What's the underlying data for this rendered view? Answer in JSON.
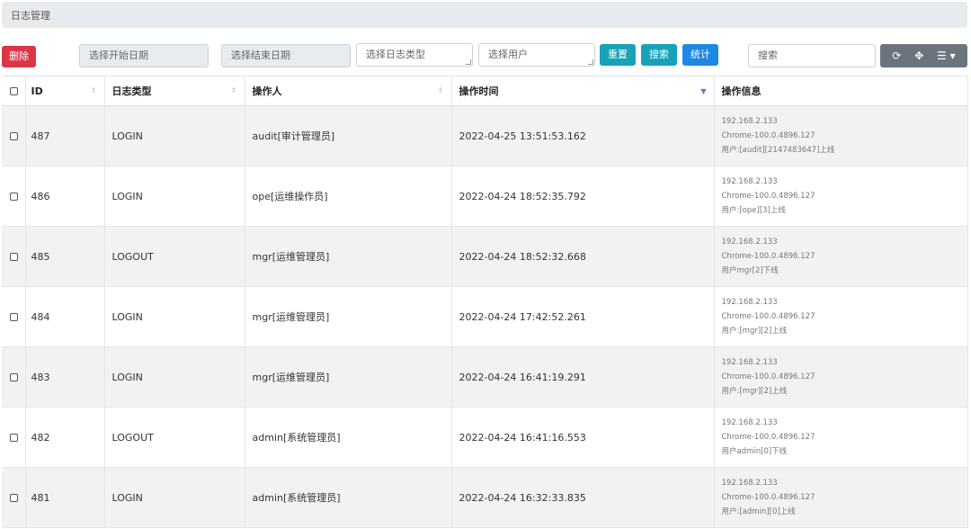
{
  "breadcrumb": {
    "title": "日志管理"
  },
  "toolbar": {
    "delete_label": "删除",
    "start_date_placeholder": "选择开始日期",
    "end_date_placeholder": "选择结束日期",
    "log_type_placeholder": "选择日志类型",
    "user_placeholder": "选择用户",
    "reset_label": "重置",
    "search_label": "搜索",
    "stats_label": "统计",
    "search_placeholder": "搜索",
    "refresh_icon": "⟳",
    "move_icon": "✥",
    "columns_icon": "☰ ▾"
  },
  "table": {
    "headers": {
      "id": "ID",
      "type": "日志类型",
      "operator": "操作人",
      "time": "操作时间",
      "info": "操作信息"
    },
    "rows": [
      {
        "id": "487",
        "type": "LOGIN",
        "operator": "audit[审计管理员]",
        "time": "2022-04-25 13:51:53.162",
        "ip": "192.168.2.133",
        "agent": "Chrome-100.0.4896.127",
        "msg": "用户:[audit][2147483647]上线"
      },
      {
        "id": "486",
        "type": "LOGIN",
        "operator": "ope[运维操作员]",
        "time": "2022-04-24 18:52:35.792",
        "ip": "192.168.2.133",
        "agent": "Chrome-100.0.4896.127",
        "msg": "用户:[ope][3]上线"
      },
      {
        "id": "485",
        "type": "LOGOUT",
        "operator": "mgr[运维管理员]",
        "time": "2022-04-24 18:52:32.668",
        "ip": "192.168.2.133",
        "agent": "Chrome-100.0.4896.127",
        "msg": "用户mgr[2]下线"
      },
      {
        "id": "484",
        "type": "LOGIN",
        "operator": "mgr[运维管理员]",
        "time": "2022-04-24 17:42:52.261",
        "ip": "192.168.2.133",
        "agent": "Chrome-100.0.4896.127",
        "msg": "用户:[mgr][2]上线"
      },
      {
        "id": "483",
        "type": "LOGIN",
        "operator": "mgr[运维管理员]",
        "time": "2022-04-24 16:41:19.291",
        "ip": "192.168.2.133",
        "agent": "Chrome-100.0.4896.127",
        "msg": "用户:[mgr][2]上线"
      },
      {
        "id": "482",
        "type": "LOGOUT",
        "operator": "admin[系统管理员]",
        "time": "2022-04-24 16:41:16.553",
        "ip": "192.168.2.133",
        "agent": "Chrome-100.0.4896.127",
        "msg": "用户admin[0]下线"
      },
      {
        "id": "481",
        "type": "LOGIN",
        "operator": "admin[系统管理员]",
        "time": "2022-04-24 16:32:33.835",
        "ip": "192.168.2.133",
        "agent": "Chrome-100.0.4896.127",
        "msg": "用户:[admin][0]上线"
      }
    ]
  }
}
